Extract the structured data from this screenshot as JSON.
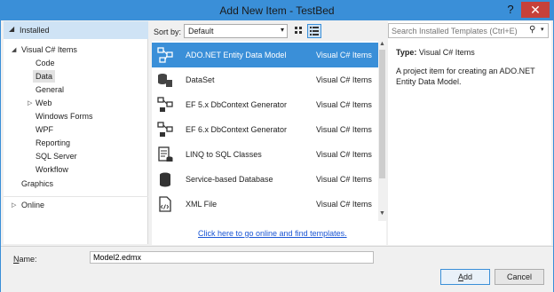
{
  "window": {
    "title": "Add New Item - TestBed",
    "help_glyph": "?",
    "close_glyph": "✕"
  },
  "left": {
    "installed": "Installed",
    "tree": [
      {
        "label": "Visual C# Items",
        "arrow": "◢"
      },
      {
        "label": "Code"
      },
      {
        "label": "Data"
      },
      {
        "label": "General"
      },
      {
        "label": "Web",
        "arrow": "▷"
      },
      {
        "label": "Windows Forms"
      },
      {
        "label": "WPF"
      },
      {
        "label": "Reporting"
      },
      {
        "label": "SQL Server"
      },
      {
        "label": "Workflow"
      },
      {
        "label": "Graphics"
      }
    ],
    "online": "Online",
    "online_arrow": "▷"
  },
  "toolbar": {
    "sort_label": "Sort by:",
    "sort_value": "Default",
    "dropdown_glyph": "▾"
  },
  "templates": [
    {
      "name": "ADO.NET Entity Data Model",
      "category": "Visual C# Items",
      "icon": "entity-model-icon"
    },
    {
      "name": "DataSet",
      "category": "Visual C# Items",
      "icon": "database-icon"
    },
    {
      "name": "EF 5.x DbContext Generator",
      "category": "Visual C# Items",
      "icon": "ef-generator-icon"
    },
    {
      "name": "EF 6.x DbContext Generator",
      "category": "Visual C# Items",
      "icon": "ef-generator-icon"
    },
    {
      "name": "LINQ to SQL Classes",
      "category": "Visual C# Items",
      "icon": "linq-icon"
    },
    {
      "name": "Service-based Database",
      "category": "Visual C# Items",
      "icon": "database-icon"
    },
    {
      "name": "XML File",
      "category": "Visual C# Items",
      "icon": "xml-file-icon"
    }
  ],
  "online_link": "Click here to go online and find templates.",
  "search": {
    "placeholder": "Search Installed Templates (Ctrl+E)",
    "icon_glyph": "⚲",
    "dropdown_glyph": "▾"
  },
  "details": {
    "type_label": "Type:",
    "type_value": "Visual C# Items",
    "description": "A project item for creating an ADO.NET Entity Data Model."
  },
  "name_field": {
    "label_first": "N",
    "label_rest": "ame:",
    "value": "Model2.edmx"
  },
  "buttons": {
    "add_first": "A",
    "add_rest": "dd",
    "cancel": "Cancel"
  },
  "colors": {
    "accent": "#3a8fd8",
    "selection_bg": "#cfe3f5",
    "close_red": "#c7413a",
    "link": "#1a55d4"
  }
}
